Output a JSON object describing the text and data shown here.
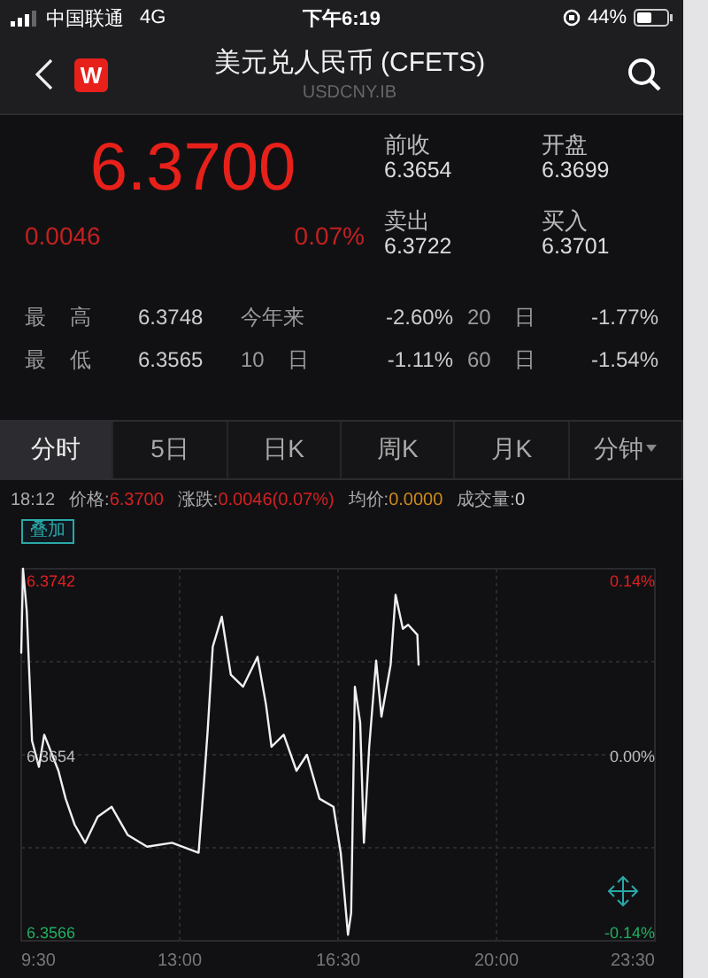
{
  "status_bar": {
    "carrier": "中国联通",
    "network": "4G",
    "time": "下午6:19",
    "battery": "44%"
  },
  "header": {
    "logo": "W",
    "title": "美元兑人民币 (CFETS)",
    "subtitle": "USDCNY.IB"
  },
  "quote": {
    "price": "6.3700",
    "change": "0.0046",
    "change_pct": "0.07%",
    "fields": [
      {
        "label": "前收",
        "value": "6.3654"
      },
      {
        "label": "开盘",
        "value": "6.3699"
      },
      {
        "label": "卖出",
        "value": "6.3722"
      },
      {
        "label": "买入",
        "value": "6.3701"
      }
    ]
  },
  "stats": [
    [
      {
        "label": "最 高",
        "value": "6.3748"
      },
      {
        "label": "今年来",
        "value": "-2.60%"
      },
      {
        "label": "20 日",
        "value": "-1.77%"
      }
    ],
    [
      {
        "label": "最 低",
        "value": "6.3565"
      },
      {
        "label": "10 日",
        "value": "-1.11%"
      },
      {
        "label": "60 日",
        "value": "-1.54%"
      }
    ]
  ],
  "tabs": [
    {
      "label": "分时",
      "selected": true,
      "dropdown": false
    },
    {
      "label": "5日",
      "selected": false,
      "dropdown": false
    },
    {
      "label": "日K",
      "selected": false,
      "dropdown": false
    },
    {
      "label": "周K",
      "selected": false,
      "dropdown": false
    },
    {
      "label": "月K",
      "selected": false,
      "dropdown": false
    },
    {
      "label": "分钟",
      "selected": false,
      "dropdown": true
    }
  ],
  "info_line": {
    "time": "18:12",
    "items": [
      {
        "label": "价格:",
        "value": "6.3700",
        "color": "#d42020"
      },
      {
        "label": "涨跌:",
        "value": "0.0046(0.07%)",
        "color": "#d42020"
      },
      {
        "label": "均价:",
        "value": "0.0000",
        "color": "#d08a1c"
      },
      {
        "label": "成交量:",
        "value": "0",
        "color": "#cccccc"
      }
    ]
  },
  "chart": {
    "overlay_button": "叠加",
    "right_labels": [
      "0.14%",
      "0.00%",
      "-0.14%"
    ],
    "chart_data": {
      "type": "line",
      "grid": true,
      "xlim": [
        9.5,
        23.5
      ],
      "ylim": [
        6.3562,
        6.3748
      ],
      "xticks": [
        {
          "value": 9.5,
          "label": "9:30"
        },
        {
          "value": 13,
          "label": "13:00"
        },
        {
          "value": 16.5,
          "label": "16:30"
        },
        {
          "value": 20,
          "label": "20:00"
        },
        {
          "value": 23.5,
          "label": "23:30"
        }
      ],
      "yticks": [
        {
          "value": 6.3742,
          "label": "6.3742"
        },
        {
          "value": 6.3654,
          "label": "6.3654"
        },
        {
          "value": 6.3566,
          "label": "6.3566"
        }
      ],
      "x": [
        9.5,
        9.54,
        9.62,
        9.74,
        9.89,
        10.01,
        10.32,
        10.48,
        10.68,
        10.91,
        11.19,
        11.5,
        11.85,
        12.28,
        12.83,
        13.42,
        13.54,
        13.62,
        13.73,
        13.93,
        14.13,
        14.4,
        14.72,
        14.91,
        15.03,
        15.3,
        15.58,
        15.81,
        16.09,
        16.4,
        16.56,
        16.72,
        16.79,
        16.87,
        16.99,
        17.07,
        17.19,
        17.34,
        17.46,
        17.66,
        17.77,
        17.93,
        18.05,
        18.25,
        18.28
      ],
      "series": [
        {
          "color": "#f0f0f0",
          "values": [
            6.3706,
            6.3748,
            6.3727,
            6.3662,
            6.3649,
            6.3665,
            6.3647,
            6.3633,
            6.362,
            6.3611,
            6.3624,
            6.3629,
            6.3615,
            6.3609,
            6.3611,
            6.3606,
            6.3642,
            6.3668,
            6.3709,
            6.3724,
            6.3695,
            6.3689,
            6.3704,
            6.368,
            6.3659,
            6.3665,
            6.3647,
            6.3655,
            6.3633,
            6.3629,
            6.3606,
            6.3565,
            6.3576,
            6.3689,
            6.3671,
            6.3611,
            6.3659,
            6.3702,
            6.3674,
            6.37,
            6.3735,
            6.3718,
            6.372,
            6.3715,
            6.37
          ]
        }
      ]
    }
  }
}
